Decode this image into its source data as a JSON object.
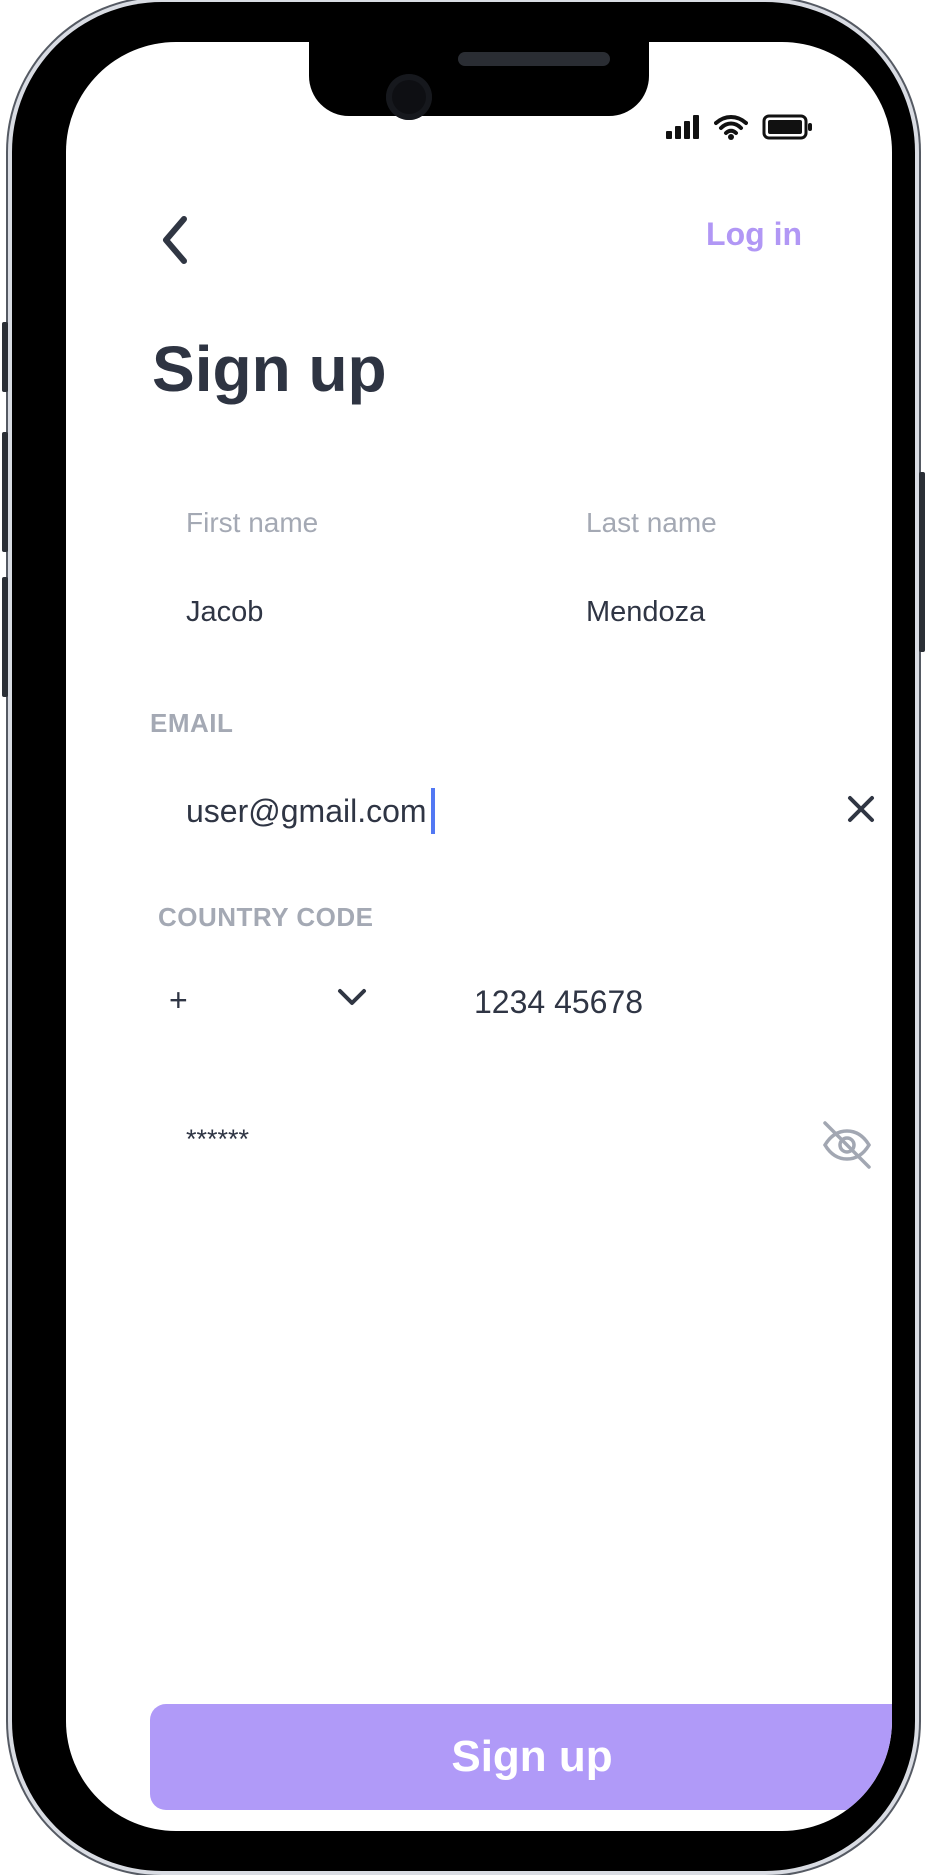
{
  "app": {
    "title": "Sign up",
    "log_in_label": "Log in"
  },
  "form": {
    "first_name": {
      "label": "First name",
      "value": "Jacob"
    },
    "last_name": {
      "label": "Last name",
      "value": "Mendoza"
    },
    "email": {
      "label": "EMAIL",
      "value": "user@gmail.com"
    },
    "country_code": {
      "label": "COUNTRY CODE",
      "prefix": "+",
      "phone_value": "1234 45678"
    },
    "password": {
      "value": "******"
    },
    "submit_label": "Sign up"
  },
  "icons": {
    "back": "back-chevron-icon",
    "clear": "close-icon",
    "dropdown": "chevron-down-icon",
    "visibility": "eye-off-icon",
    "signal": "signal-icon",
    "wifi": "wifi-icon",
    "battery": "battery-icon"
  },
  "colors": {
    "accent": "#b197f5",
    "button": "#b09af8",
    "title": "#2e3442",
    "muted": "#a4a9b4",
    "caret": "#5278f3"
  }
}
